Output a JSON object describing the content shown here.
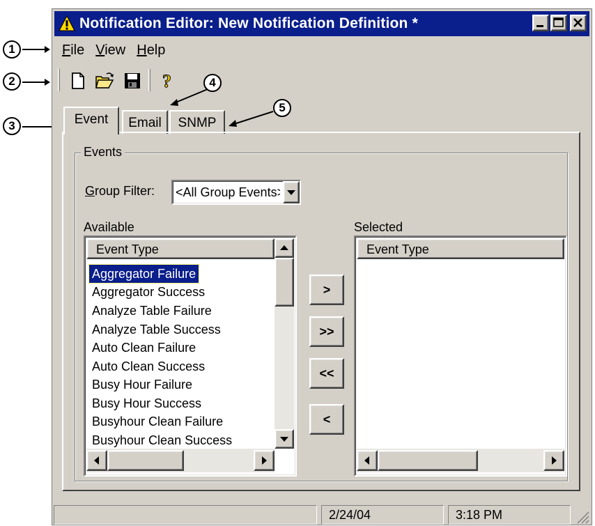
{
  "window": {
    "title": "Notification Editor: New Notification Definition *"
  },
  "menu": {
    "items": [
      {
        "label": "File",
        "mnemonic": "F",
        "rest": "ile"
      },
      {
        "label": "View",
        "mnemonic": "V",
        "rest": "iew"
      },
      {
        "label": "Help",
        "mnemonic": "H",
        "rest": "elp"
      }
    ]
  },
  "toolbar": {
    "icons": [
      "new-document-icon",
      "open-folder-icon",
      "save-disk-icon",
      "help-question-icon"
    ]
  },
  "tabs": [
    {
      "label": "Event",
      "active": true
    },
    {
      "label": "Email",
      "active": false
    },
    {
      "label": "SNMP",
      "active": false
    }
  ],
  "events_group": {
    "legend": "Events",
    "group_filter_mnemonic": "G",
    "group_filter_rest": "roup Filter:",
    "group_filter_value": "<All Group Events>"
  },
  "available": {
    "label": "Available",
    "column_header": "Event Type",
    "items": [
      "Aggregator Failure",
      "Aggregator Success",
      "Analyze Table Failure",
      "Analyze Table Success",
      "Auto Clean Failure",
      "Auto Clean Success",
      "Busy Hour Failure",
      "Busy Hour Success",
      "Busyhour Clean Failure",
      "Busyhour Clean Success"
    ],
    "selected_index": 0
  },
  "selected": {
    "label": "Selected",
    "column_header": "Event Type",
    "items": []
  },
  "move_buttons": {
    "add": ">",
    "add_all": ">>",
    "remove_all": "<<",
    "remove": "<"
  },
  "status": {
    "message": "",
    "date": "2/24/04",
    "time": "3:18 PM"
  },
  "callouts": [
    "1",
    "2",
    "3",
    "4",
    "5"
  ],
  "colors": {
    "titlebar": "#0a1e8c",
    "face": "#d4d0c8",
    "selection": "#0a1e8c"
  }
}
